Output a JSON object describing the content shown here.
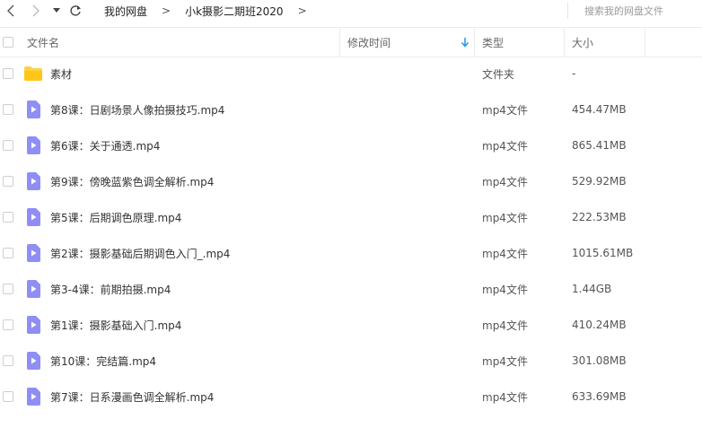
{
  "nav": {
    "back_icon": "chevron-left-icon",
    "forward_icon": "chevron-right-icon",
    "dropdown_icon": "caret-down-icon",
    "refresh_icon": "refresh-icon"
  },
  "breadcrumb": {
    "root": "我的网盘",
    "separator": ">",
    "current": "小k摄影二期班2020",
    "trailing_separator": ">"
  },
  "search": {
    "placeholder": "搜索我的网盘文件"
  },
  "columns": {
    "name": "文件名",
    "modified": "修改时间",
    "type": "类型",
    "size": "大小",
    "sort_icon": "arrow-down-icon",
    "sort_color": "#1a9bf0"
  },
  "colors": {
    "folder": "#ffd043",
    "video": "#8f8ef5"
  },
  "files": [
    {
      "name": "素材",
      "type": "文件夹",
      "size": "-",
      "icon": "folder-icon"
    },
    {
      "name": "第8课：日剧场景人像拍摄技巧.mp4",
      "type": "mp4文件",
      "size": "454.47MB",
      "icon": "video-file-icon"
    },
    {
      "name": "第6课：关于通透.mp4",
      "type": "mp4文件",
      "size": "865.41MB",
      "icon": "video-file-icon"
    },
    {
      "name": "第9课：傍晚蓝紫色调全解析.mp4",
      "type": "mp4文件",
      "size": "529.92MB",
      "icon": "video-file-icon"
    },
    {
      "name": "第5课：后期调色原理.mp4",
      "type": "mp4文件",
      "size": "222.53MB",
      "icon": "video-file-icon"
    },
    {
      "name": "第2课：摄影基础后期调色入门_.mp4",
      "type": "mp4文件",
      "size": "1015.61MB",
      "icon": "video-file-icon"
    },
    {
      "name": "第3-4课：前期拍摄.mp4",
      "type": "mp4文件",
      "size": "1.44GB",
      "icon": "video-file-icon"
    },
    {
      "name": "第1课：摄影基础入门.mp4",
      "type": "mp4文件",
      "size": "410.24MB",
      "icon": "video-file-icon"
    },
    {
      "name": "第10课：完结篇.mp4",
      "type": "mp4文件",
      "size": "301.08MB",
      "icon": "video-file-icon"
    },
    {
      "name": "第7课：日系漫画色调全解析.mp4",
      "type": "mp4文件",
      "size": "633.69MB",
      "icon": "video-file-icon"
    }
  ]
}
